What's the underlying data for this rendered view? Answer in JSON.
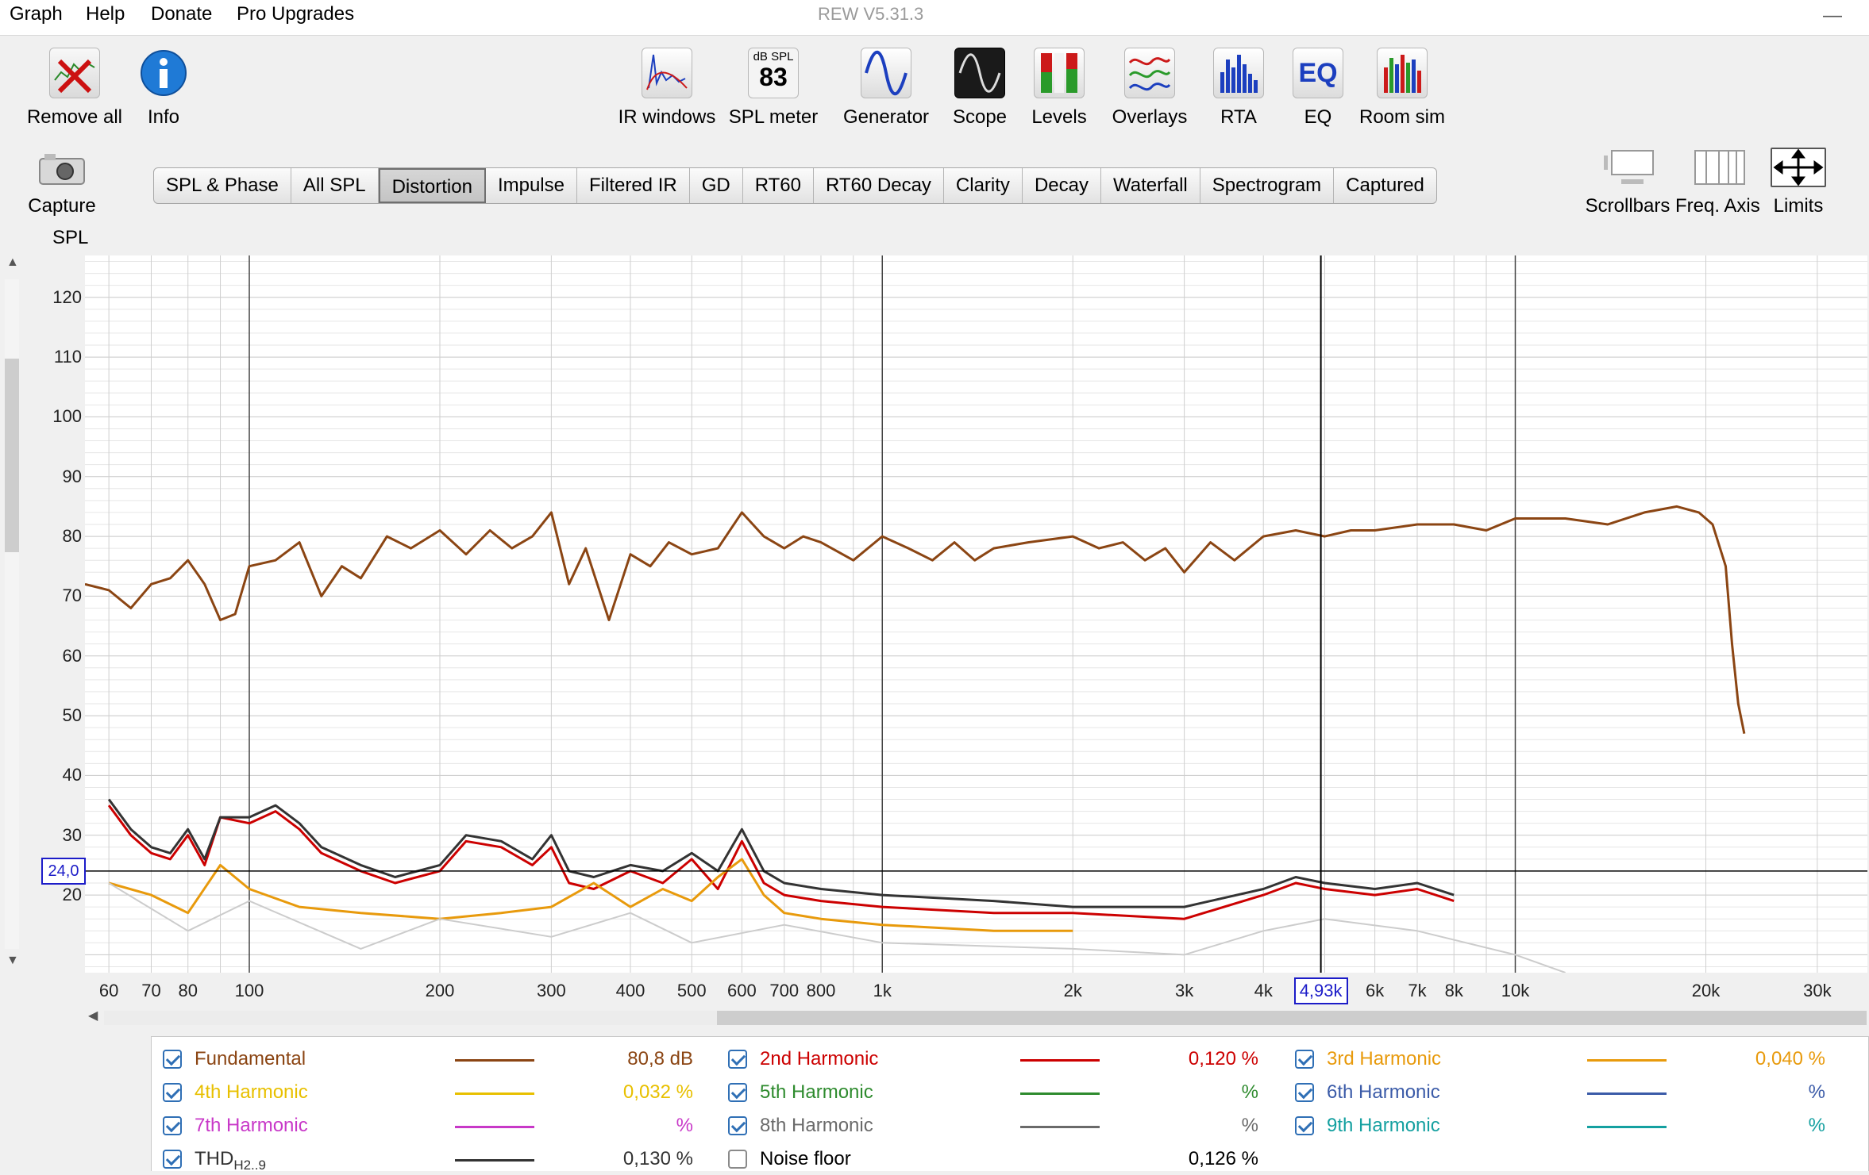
{
  "menu": {
    "items": [
      "Graph",
      "Help",
      "Donate",
      "Pro Upgrades"
    ],
    "title": "REW V5.31.3",
    "minimize": "—"
  },
  "toolbar": {
    "left": [
      {
        "label": "Remove all",
        "icon": "remove-all-icon"
      },
      {
        "label": "Info",
        "icon": "info-icon"
      },
      {
        "label": "Capture",
        "icon": "camera-icon"
      }
    ],
    "tools": [
      {
        "label": "IR windows",
        "icon": "ir-windows-icon"
      },
      {
        "label": "SPL meter",
        "icon": "spl-meter-icon",
        "badge_top": "dB SPL",
        "badge_value": "83"
      },
      {
        "label": "Generator",
        "icon": "generator-icon"
      },
      {
        "label": "Scope",
        "icon": "scope-icon"
      },
      {
        "label": "Levels",
        "icon": "levels-icon"
      },
      {
        "label": "Overlays",
        "icon": "overlays-icon"
      },
      {
        "label": "RTA",
        "icon": "rta-icon"
      },
      {
        "label": "EQ",
        "icon": "eq-icon",
        "badge_value": "EQ"
      },
      {
        "label": "Room sim",
        "icon": "room-sim-icon"
      }
    ],
    "right": [
      {
        "label": "Scrollbars",
        "icon": "scrollbars-icon"
      },
      {
        "label": "Freq. Axis",
        "icon": "freq-axis-icon"
      },
      {
        "label": "Limits",
        "icon": "limits-icon"
      }
    ]
  },
  "tabs": [
    "SPL & Phase",
    "All SPL",
    "Distortion",
    "Impulse",
    "Filtered IR",
    "GD",
    "RT60",
    "RT60 Decay",
    "Clarity",
    "Decay",
    "Waterfall",
    "Spectrogram",
    "Captured"
  ],
  "active_tab": "Distortion",
  "graph": {
    "y_axis_title": "SPL",
    "cursor": {
      "x_label": "4,93k",
      "y_label": "24,0",
      "x_hz": 4930,
      "y_db": 24.0
    }
  },
  "chart_data": {
    "type": "line",
    "x_scale": "log",
    "xlim": [
      55,
      36000
    ],
    "ylim": [
      7,
      127
    ],
    "grid": true,
    "x_ticks": [
      {
        "v": 60,
        "t": "60"
      },
      {
        "v": 70,
        "t": "70"
      },
      {
        "v": 80,
        "t": "80"
      },
      {
        "v": 100,
        "t": "100"
      },
      {
        "v": 200,
        "t": "200"
      },
      {
        "v": 300,
        "t": "300"
      },
      {
        "v": 400,
        "t": "400"
      },
      {
        "v": 500,
        "t": "500"
      },
      {
        "v": 600,
        "t": "600"
      },
      {
        "v": 700,
        "t": "700"
      },
      {
        "v": 800,
        "t": "800"
      },
      {
        "v": 1000,
        "t": "1k"
      },
      {
        "v": 2000,
        "t": "2k"
      },
      {
        "v": 3000,
        "t": "3k"
      },
      {
        "v": 4000,
        "t": "4k"
      },
      {
        "v": 6000,
        "t": "6k"
      },
      {
        "v": 7000,
        "t": "7k"
      },
      {
        "v": 8000,
        "t": "8k"
      },
      {
        "v": 10000,
        "t": "10k"
      },
      {
        "v": 20000,
        "t": "20k"
      },
      {
        "v": 30000,
        "t": "30k"
      }
    ],
    "y_ticks": [
      20,
      30,
      40,
      50,
      60,
      70,
      80,
      90,
      100,
      110,
      120
    ],
    "series": [
      {
        "name": "Fundamental",
        "color": "#8b4513",
        "width": 3,
        "points": [
          [
            55,
            72
          ],
          [
            60,
            71
          ],
          [
            65,
            68
          ],
          [
            70,
            72
          ],
          [
            75,
            73
          ],
          [
            80,
            76
          ],
          [
            85,
            72
          ],
          [
            90,
            66
          ],
          [
            95,
            67
          ],
          [
            100,
            75
          ],
          [
            110,
            76
          ],
          [
            120,
            79
          ],
          [
            130,
            70
          ],
          [
            140,
            75
          ],
          [
            150,
            73
          ],
          [
            165,
            80
          ],
          [
            180,
            78
          ],
          [
            200,
            81
          ],
          [
            220,
            77
          ],
          [
            240,
            81
          ],
          [
            260,
            78
          ],
          [
            280,
            80
          ],
          [
            300,
            84
          ],
          [
            320,
            72
          ],
          [
            340,
            78
          ],
          [
            370,
            66
          ],
          [
            400,
            77
          ],
          [
            430,
            75
          ],
          [
            460,
            79
          ],
          [
            500,
            77
          ],
          [
            550,
            78
          ],
          [
            600,
            84
          ],
          [
            650,
            80
          ],
          [
            700,
            78
          ],
          [
            750,
            80
          ],
          [
            800,
            79
          ],
          [
            900,
            76
          ],
          [
            1000,
            80
          ],
          [
            1100,
            78
          ],
          [
            1200,
            76
          ],
          [
            1300,
            79
          ],
          [
            1400,
            76
          ],
          [
            1500,
            78
          ],
          [
            1700,
            79
          ],
          [
            2000,
            80
          ],
          [
            2200,
            78
          ],
          [
            2400,
            79
          ],
          [
            2600,
            76
          ],
          [
            2800,
            78
          ],
          [
            3000,
            74
          ],
          [
            3300,
            79
          ],
          [
            3600,
            76
          ],
          [
            4000,
            80
          ],
          [
            4500,
            81
          ],
          [
            5000,
            80
          ],
          [
            5500,
            81
          ],
          [
            6000,
            81
          ],
          [
            7000,
            82
          ],
          [
            8000,
            82
          ],
          [
            9000,
            81
          ],
          [
            10000,
            83
          ],
          [
            12000,
            83
          ],
          [
            14000,
            82
          ],
          [
            16000,
            84
          ],
          [
            18000,
            85
          ],
          [
            19500,
            84
          ],
          [
            20500,
            82
          ],
          [
            21500,
            75
          ],
          [
            22000,
            62
          ],
          [
            22500,
            52
          ],
          [
            23000,
            47
          ]
        ]
      },
      {
        "name": "2nd Harmonic",
        "color": "#cc0000",
        "width": 3,
        "points": [
          [
            60,
            35
          ],
          [
            65,
            30
          ],
          [
            70,
            27
          ],
          [
            75,
            26
          ],
          [
            80,
            30
          ],
          [
            85,
            25
          ],
          [
            90,
            33
          ],
          [
            100,
            32
          ],
          [
            110,
            34
          ],
          [
            120,
            31
          ],
          [
            130,
            27
          ],
          [
            150,
            24
          ],
          [
            170,
            22
          ],
          [
            200,
            24
          ],
          [
            220,
            29
          ],
          [
            250,
            28
          ],
          [
            280,
            25
          ],
          [
            300,
            28
          ],
          [
            320,
            22
          ],
          [
            350,
            21
          ],
          [
            400,
            24
          ],
          [
            450,
            22
          ],
          [
            500,
            26
          ],
          [
            550,
            21
          ],
          [
            600,
            29
          ],
          [
            650,
            22
          ],
          [
            700,
            20
          ],
          [
            800,
            19
          ],
          [
            1000,
            18
          ],
          [
            1500,
            17
          ],
          [
            2000,
            17
          ],
          [
            3000,
            16
          ],
          [
            4000,
            20
          ],
          [
            4500,
            22
          ],
          [
            5000,
            21
          ],
          [
            6000,
            20
          ],
          [
            7000,
            21
          ],
          [
            8000,
            19
          ]
        ]
      },
      {
        "name": "3rd Harmonic",
        "color": "#e89a0c",
        "width": 3,
        "points": [
          [
            60,
            22
          ],
          [
            70,
            20
          ],
          [
            80,
            17
          ],
          [
            90,
            25
          ],
          [
            100,
            21
          ],
          [
            120,
            18
          ],
          [
            150,
            17
          ],
          [
            200,
            16
          ],
          [
            250,
            17
          ],
          [
            300,
            18
          ],
          [
            350,
            22
          ],
          [
            400,
            18
          ],
          [
            450,
            21
          ],
          [
            500,
            19
          ],
          [
            550,
            23
          ],
          [
            600,
            26
          ],
          [
            650,
            20
          ],
          [
            700,
            17
          ],
          [
            800,
            16
          ],
          [
            1000,
            15
          ],
          [
            1500,
            14
          ],
          [
            2000,
            14
          ]
        ]
      },
      {
        "name": "THD",
        "color": "#333333",
        "width": 3,
        "points": [
          [
            60,
            36
          ],
          [
            65,
            31
          ],
          [
            70,
            28
          ],
          [
            75,
            27
          ],
          [
            80,
            31
          ],
          [
            85,
            26
          ],
          [
            90,
            33
          ],
          [
            100,
            33
          ],
          [
            110,
            35
          ],
          [
            120,
            32
          ],
          [
            130,
            28
          ],
          [
            150,
            25
          ],
          [
            170,
            23
          ],
          [
            200,
            25
          ],
          [
            220,
            30
          ],
          [
            250,
            29
          ],
          [
            280,
            26
          ],
          [
            300,
            30
          ],
          [
            320,
            24
          ],
          [
            350,
            23
          ],
          [
            400,
            25
          ],
          [
            450,
            24
          ],
          [
            500,
            27
          ],
          [
            550,
            24
          ],
          [
            600,
            31
          ],
          [
            650,
            24
          ],
          [
            700,
            22
          ],
          [
            800,
            21
          ],
          [
            1000,
            20
          ],
          [
            1500,
            19
          ],
          [
            2000,
            18
          ],
          [
            3000,
            18
          ],
          [
            4000,
            21
          ],
          [
            4500,
            23
          ],
          [
            5000,
            22
          ],
          [
            6000,
            21
          ],
          [
            7000,
            22
          ],
          [
            8000,
            20
          ]
        ]
      },
      {
        "name": "Noise floor",
        "color": "#cccccc",
        "width": 2,
        "points": [
          [
            60,
            22
          ],
          [
            80,
            14
          ],
          [
            100,
            19
          ],
          [
            150,
            11
          ],
          [
            200,
            16
          ],
          [
            300,
            13
          ],
          [
            400,
            17
          ],
          [
            500,
            12
          ],
          [
            700,
            15
          ],
          [
            1000,
            12
          ],
          [
            2000,
            11
          ],
          [
            3000,
            10
          ],
          [
            4000,
            14
          ],
          [
            5000,
            16
          ],
          [
            7000,
            14
          ],
          [
            10000,
            10
          ],
          [
            12000,
            7
          ]
        ]
      }
    ]
  },
  "legend": [
    {
      "name": "Fundamental",
      "color": "#8b4513",
      "value": "80,8 dB",
      "checked": true
    },
    {
      "name": "2nd Harmonic",
      "color": "#cc0000",
      "value": "0,120 %",
      "checked": true
    },
    {
      "name": "3rd Harmonic",
      "color": "#e89a0c",
      "value": "0,040 %",
      "checked": true
    },
    {
      "name": "4th Harmonic",
      "color": "#e8c000",
      "value": "0,032 %",
      "checked": true
    },
    {
      "name": "5th Harmonic",
      "color": "#2e8b2e",
      "value": "%",
      "checked": true
    },
    {
      "name": "6th Harmonic",
      "color": "#3b5ba8",
      "value": "%",
      "checked": true
    },
    {
      "name": "7th Harmonic",
      "color": "#c838c8",
      "value": "%",
      "checked": true
    },
    {
      "name": "8th Harmonic",
      "color": "#6a6a6a",
      "value": "%",
      "checked": true
    },
    {
      "name": "9th Harmonic",
      "color": "#14a0a0",
      "value": "%",
      "checked": true
    },
    {
      "name": "THD",
      "sub": "H2..9",
      "color": "#333333",
      "value": "0,130 %",
      "checked": true
    },
    {
      "name": "Noise floor",
      "color": "",
      "value": "0,126 %",
      "checked": false
    }
  ]
}
